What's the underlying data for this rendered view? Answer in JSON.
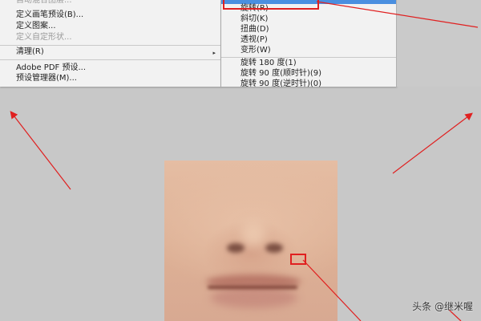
{
  "edit_menu": {
    "items": [
      {
        "label": "自动混合图层...",
        "disabled": true
      },
      {
        "label": "定义画笔预设(B)...",
        "disabled": false
      },
      {
        "label": "定义图案...",
        "disabled": false
      },
      {
        "label": "定义自定形状...",
        "disabled": true
      },
      {
        "label": "清理(R)",
        "disabled": false,
        "submenu": true
      },
      {
        "label": "Adobe PDF 预设...",
        "disabled": false
      },
      {
        "label": "预设管理器(M)...",
        "disabled": false
      }
    ],
    "submenu_arrow": "▸"
  },
  "transform_submenu": {
    "items": [
      {
        "label": "旋转(R)"
      },
      {
        "label": "斜切(K)"
      },
      {
        "label": "扭曲(D)"
      },
      {
        "label": "透视(P)"
      },
      {
        "label": "变形(W)"
      },
      {
        "label": "旋转 180 度(1)"
      },
      {
        "label": "旋转 90 度(顺时针)(9)"
      },
      {
        "label": "旋转 90 度(逆时针)(0)"
      }
    ]
  },
  "annotation_color": "#e02020",
  "watermark": "头条 @继米喔"
}
